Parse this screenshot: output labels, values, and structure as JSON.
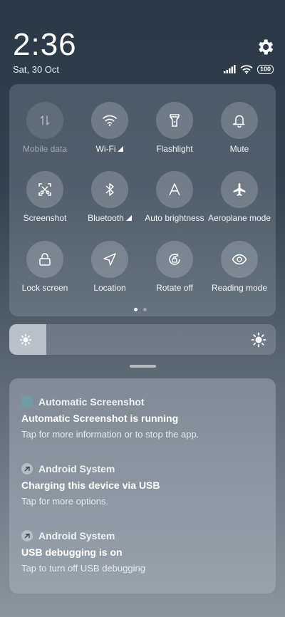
{
  "status_bar": {
    "time": "2:36",
    "date": "Sat, 30 Oct",
    "battery": "100",
    "icons": [
      "signal-icon",
      "wifi-icon",
      "battery-icon"
    ]
  },
  "quick_settings": {
    "tiles": [
      {
        "label": "Mobile data",
        "icon": "mobile-data-icon",
        "enabled": false
      },
      {
        "label": "Wi-Fi",
        "icon": "wifi-icon",
        "enabled": true
      },
      {
        "label": "Flashlight",
        "icon": "flashlight-icon",
        "enabled": true
      },
      {
        "label": "Mute",
        "icon": "bell-icon",
        "enabled": true
      },
      {
        "label": "Screenshot",
        "icon": "screenshot-icon",
        "enabled": true
      },
      {
        "label": "Bluetooth",
        "icon": "bluetooth-icon",
        "enabled": true
      },
      {
        "label": "Auto brightness",
        "icon": "auto-brightness-icon",
        "enabled": true
      },
      {
        "label": "Aeroplane mode",
        "icon": "airplane-icon",
        "enabled": true
      },
      {
        "label": "Lock screen",
        "icon": "lock-icon",
        "enabled": true
      },
      {
        "label": "Location",
        "icon": "location-icon",
        "enabled": true
      },
      {
        "label": "Rotate off",
        "icon": "rotate-lock-icon",
        "enabled": true
      },
      {
        "label": "Reading mode",
        "icon": "eye-icon",
        "enabled": true
      }
    ],
    "page_count": 2,
    "current_page": 1
  },
  "brightness": {
    "level": 0.14
  },
  "notifications": [
    {
      "app": "Automatic Screenshot",
      "title": "Automatic Screenshot is running",
      "text": "Tap for more information or to stop the app.",
      "icon": "app-square-icon"
    },
    {
      "app": "Android System",
      "title": "Charging this device via USB",
      "text": "Tap for more options.",
      "icon": "android-system-icon"
    },
    {
      "app": "Android System",
      "title": "USB debugging is on",
      "text": "Tap to turn off USB debugging",
      "icon": "android-system-icon"
    }
  ],
  "colors": {
    "accent": "#6f9ba3"
  }
}
